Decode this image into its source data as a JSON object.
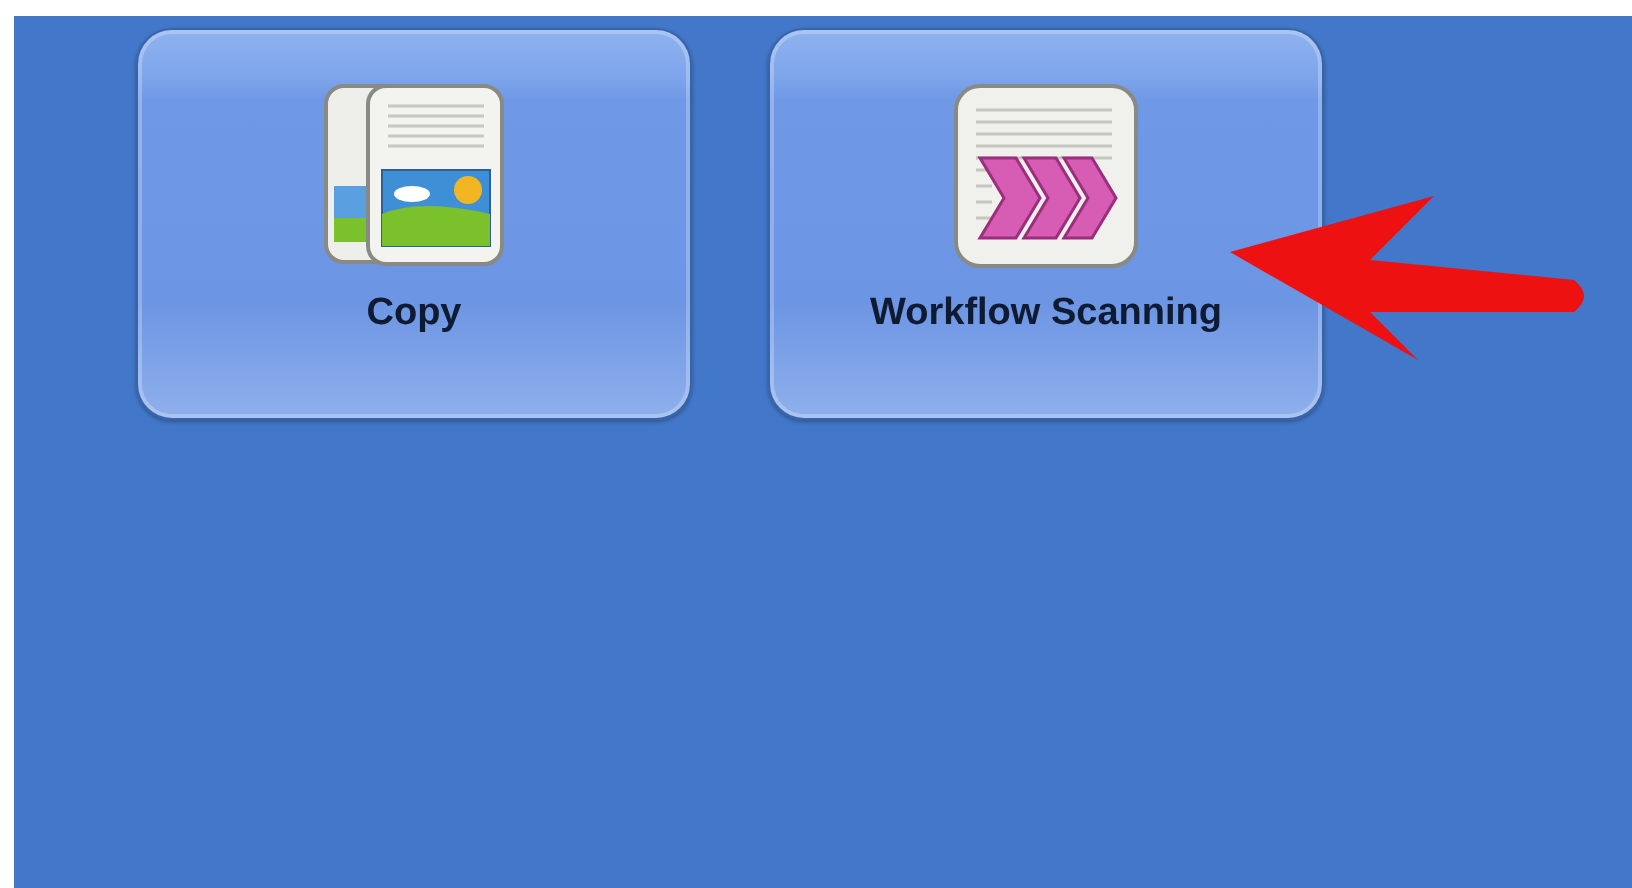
{
  "tiles": [
    {
      "label": "Copy",
      "kind": "copy"
    },
    {
      "label": "Workflow Scanning",
      "kind": "scan"
    }
  ],
  "annotation": {
    "kind": "arrow"
  }
}
